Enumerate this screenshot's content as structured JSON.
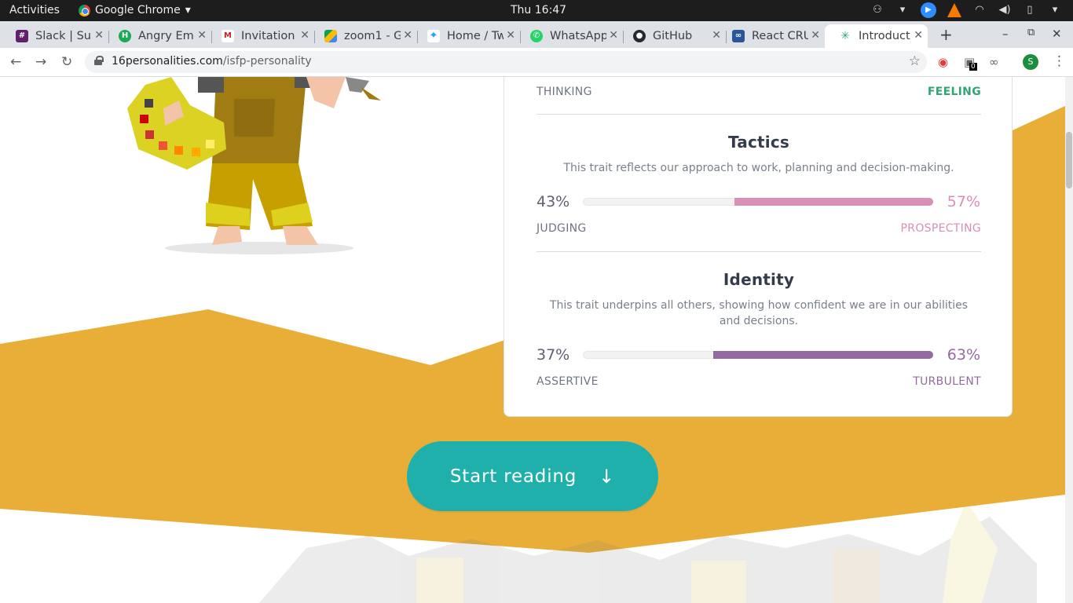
{
  "system": {
    "activities": "Activities",
    "app_name": "Google Chrome",
    "clock": "Thu 16:47"
  },
  "tabs": [
    {
      "title": "Slack | Sur",
      "favicon_color": "#611f69"
    },
    {
      "title": "Angry Em",
      "favicon_color": "#1aaa55"
    },
    {
      "title": "Invitation",
      "favicon_color": "#c5221f"
    },
    {
      "title": "zoom1 - G",
      "favicon_color": "#fbbc04"
    },
    {
      "title": "Home / Tw",
      "favicon_color": "#1da1f2"
    },
    {
      "title": "WhatsApp",
      "favicon_color": "#25d366"
    },
    {
      "title": "GitHub",
      "favicon_color": "#24292e"
    },
    {
      "title": "React CRU",
      "favicon_color": "#2b579a"
    },
    {
      "title": "Introduct",
      "favicon_color": "#33a474"
    }
  ],
  "toolbar": {
    "url_host": "16personalities.com",
    "url_path": "/isfp-personality",
    "extension_badge": "0",
    "profile_initial": "S"
  },
  "traits": {
    "nature": {
      "left_label": "THINKING",
      "right_label": "FEELING",
      "right_color": "#33a474"
    },
    "tactics": {
      "title": "Tactics",
      "description": "This trait reflects our approach to work, planning and decision-making.",
      "left_pct": "43%",
      "right_pct": "57%",
      "right_value": 57,
      "left_label": "JUDGING",
      "right_label": "PROSPECTING",
      "color": "#d98fb6"
    },
    "identity": {
      "title": "Identity",
      "description": "This trait underpins all others, showing how confident we are in our abilities and decisions.",
      "left_pct": "37%",
      "right_pct": "63%",
      "right_value": 63,
      "left_label": "ASSERTIVE",
      "right_label": "TURBULENT",
      "color": "#946b9e"
    }
  },
  "cta": {
    "label": "Start reading",
    "arrow": "↓"
  },
  "colors": {
    "band": "#e9ae38",
    "cta": "#1fb0ac",
    "text_muted": "#6f7582"
  }
}
